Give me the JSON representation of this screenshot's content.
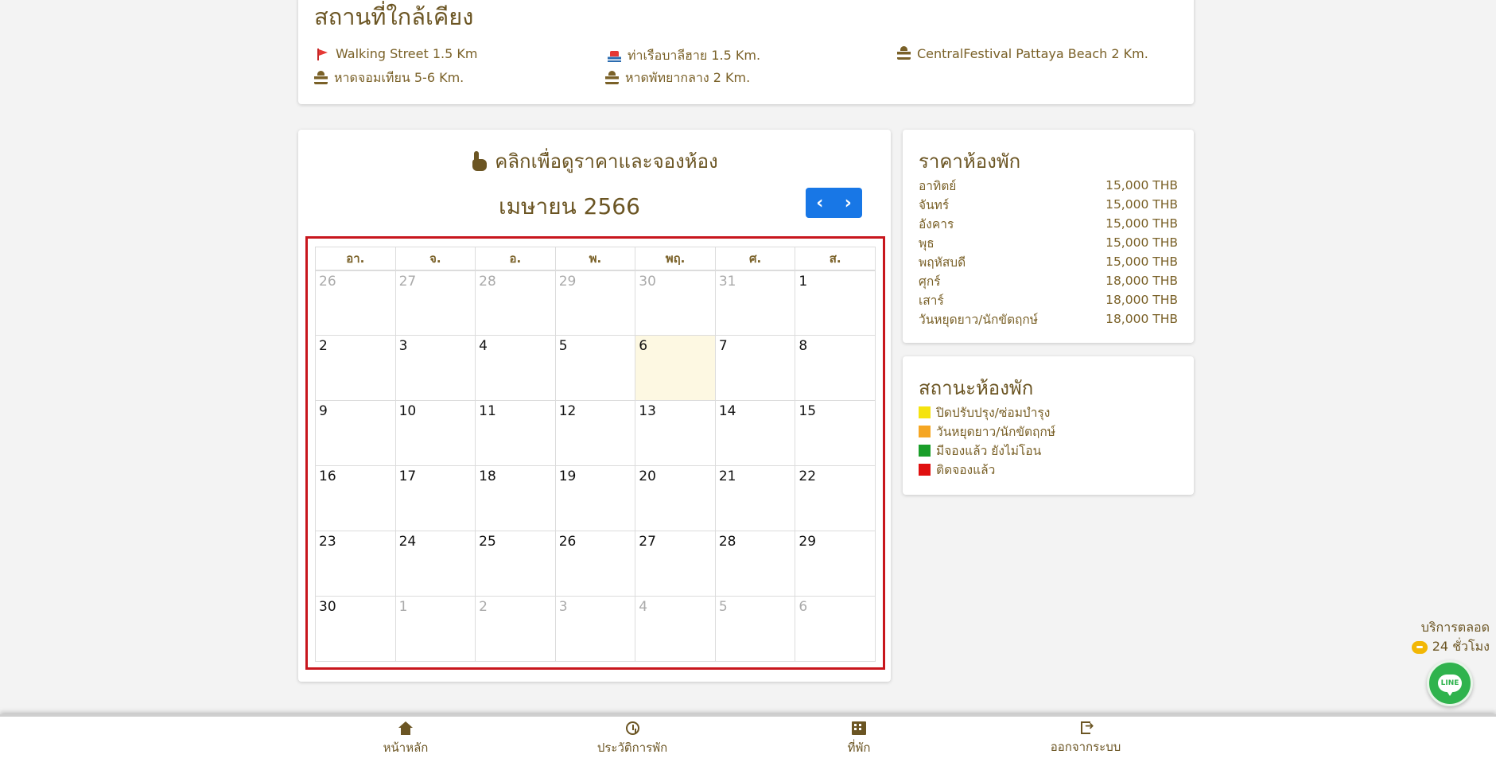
{
  "nearby": {
    "title": "สถานที่ใกล้เคียง",
    "places": [
      {
        "icon": "flag-icon",
        "label": "Walking Street 1.5 Km"
      },
      {
        "icon": "boat-icon",
        "label": "ท่าเรือบาลีฮาย 1.5 Km."
      },
      {
        "icon": "beach-icon",
        "label": "CentralFestival Pattaya Beach 2 Km."
      },
      {
        "icon": "beach-icon",
        "label": "หาดจอมเทียน 5-6 Km."
      },
      {
        "icon": "beach-icon",
        "label": "หาดพัทยากลาง 2 Km."
      }
    ]
  },
  "calendar": {
    "hint": "คลิกเพื่อดูราคาและจองห้อง",
    "month_label": "เมษายน 2566",
    "prev_label": "‹",
    "next_label": "›",
    "weekdays": [
      "อา.",
      "จ.",
      "อ.",
      "พ.",
      "พฤ.",
      "ศ.",
      "ส."
    ],
    "weeks": [
      [
        {
          "d": "26",
          "other": true
        },
        {
          "d": "27",
          "other": true
        },
        {
          "d": "28",
          "other": true
        },
        {
          "d": "29",
          "other": true
        },
        {
          "d": "30",
          "other": true
        },
        {
          "d": "31",
          "other": true
        },
        {
          "d": "1"
        }
      ],
      [
        {
          "d": "2"
        },
        {
          "d": "3"
        },
        {
          "d": "4"
        },
        {
          "d": "5"
        },
        {
          "d": "6",
          "today": true
        },
        {
          "d": "7"
        },
        {
          "d": "8"
        }
      ],
      [
        {
          "d": "9"
        },
        {
          "d": "10"
        },
        {
          "d": "11"
        },
        {
          "d": "12"
        },
        {
          "d": "13"
        },
        {
          "d": "14"
        },
        {
          "d": "15"
        }
      ],
      [
        {
          "d": "16"
        },
        {
          "d": "17"
        },
        {
          "d": "18"
        },
        {
          "d": "19"
        },
        {
          "d": "20"
        },
        {
          "d": "21"
        },
        {
          "d": "22"
        }
      ],
      [
        {
          "d": "23"
        },
        {
          "d": "24"
        },
        {
          "d": "25"
        },
        {
          "d": "26"
        },
        {
          "d": "27"
        },
        {
          "d": "28"
        },
        {
          "d": "29"
        }
      ],
      [
        {
          "d": "30"
        },
        {
          "d": "1",
          "other": true
        },
        {
          "d": "2",
          "other": true
        },
        {
          "d": "3",
          "other": true
        },
        {
          "d": "4",
          "other": true
        },
        {
          "d": "5",
          "other": true
        },
        {
          "d": "6",
          "other": true
        }
      ]
    ],
    "highlight_color": "#c8161d"
  },
  "prices": {
    "title": "ราคาห้องพัก",
    "rows": [
      {
        "day": "อาทิตย์",
        "price": "15,000 THB"
      },
      {
        "day": "จันทร์",
        "price": "15,000 THB"
      },
      {
        "day": "อังคาร",
        "price": "15,000 THB"
      },
      {
        "day": "พุธ",
        "price": "15,000 THB"
      },
      {
        "day": "พฤหัสบดี",
        "price": "15,000 THB"
      },
      {
        "day": "ศุกร์",
        "price": "18,000 THB"
      },
      {
        "day": "เสาร์",
        "price": "18,000 THB"
      },
      {
        "day": "วันหยุดยาว/นักขัตฤกษ์",
        "price": "18,000 THB"
      }
    ]
  },
  "status": {
    "title": "สถานะห้องพัก",
    "items": [
      {
        "color": "#f5e30f",
        "label": "ปิดปรับปรุง/ซ่อมบำรุง"
      },
      {
        "color": "#f5a623",
        "label": "วันหยุดยาว/นักขัตฤกษ์"
      },
      {
        "color": "#1a9e2a",
        "label": "มีจองแล้ว ยังไม่โอน"
      },
      {
        "color": "#e01010",
        "label": "ติดจองแล้ว"
      }
    ]
  },
  "service": {
    "line1": "บริการตลอด",
    "line2": "24 ชั่วโมง",
    "line_label": "LINE"
  },
  "bottom_nav": [
    {
      "icon": "home-icon",
      "label": "หน้าหลัก"
    },
    {
      "icon": "history-icon",
      "label": "ประวัติการพัก"
    },
    {
      "icon": "hotel-icon",
      "label": "ที่พัก"
    },
    {
      "icon": "logout-icon",
      "label": "ออกจากระบบ"
    }
  ]
}
